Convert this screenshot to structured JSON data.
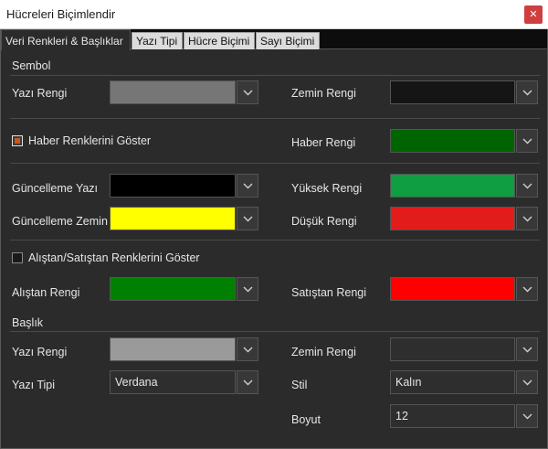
{
  "window": {
    "title": "Hücreleri Biçimlendir"
  },
  "tabs": [
    {
      "label": "Veri Renkleri & Başlıklar",
      "active": true
    },
    {
      "label": "Yazı Tipi",
      "active": false
    },
    {
      "label": "Hücre Biçimi",
      "active": false
    },
    {
      "label": "Sayı Biçimi",
      "active": false
    }
  ],
  "sembol": {
    "title": "Sembol",
    "yazi_rengi": {
      "label": "Yazı Rengi",
      "color": "#767676"
    },
    "zemin_rengi": {
      "label": "Zemin Rengi",
      "color": "#151515"
    }
  },
  "haber": {
    "checkbox_label": "Haber Renklerini Göster",
    "checked": true,
    "haber_rengi": {
      "label": "Haber Rengi",
      "color": "#006400"
    }
  },
  "guncelleme": {
    "yazi": {
      "label": "Güncelleme Yazı",
      "color": "#000000"
    },
    "zemin": {
      "label": "Güncelleme Zemin",
      "color": "#ffff00"
    },
    "yuksek": {
      "label": "Yüksek Rengi",
      "color": "#0f9e42"
    },
    "dusuk": {
      "label": "Düşük Rengi",
      "color": "#e21b1b"
    }
  },
  "alistan": {
    "checkbox_label": "Alıştan/Satıştan Renklerini Göster",
    "checked": false,
    "alistan_rengi": {
      "label": "Alıştan Rengi",
      "color": "#008000"
    },
    "satistan_rengi": {
      "label": "Satıştan Rengi",
      "color": "#ff0000"
    }
  },
  "baslik": {
    "title": "Başlık",
    "yazi_rengi": {
      "label": "Yazı Rengi",
      "color": "#9a9a9a"
    },
    "zemin_rengi": {
      "label": "Zemin Rengi",
      "color": "#2e2e2e"
    },
    "yazi_tipi": {
      "label": "Yazı Tipi",
      "value": "Verdana"
    },
    "stil": {
      "label": "Stil",
      "value": "Kalın"
    },
    "boyut": {
      "label": "Boyut",
      "value": "12"
    }
  }
}
